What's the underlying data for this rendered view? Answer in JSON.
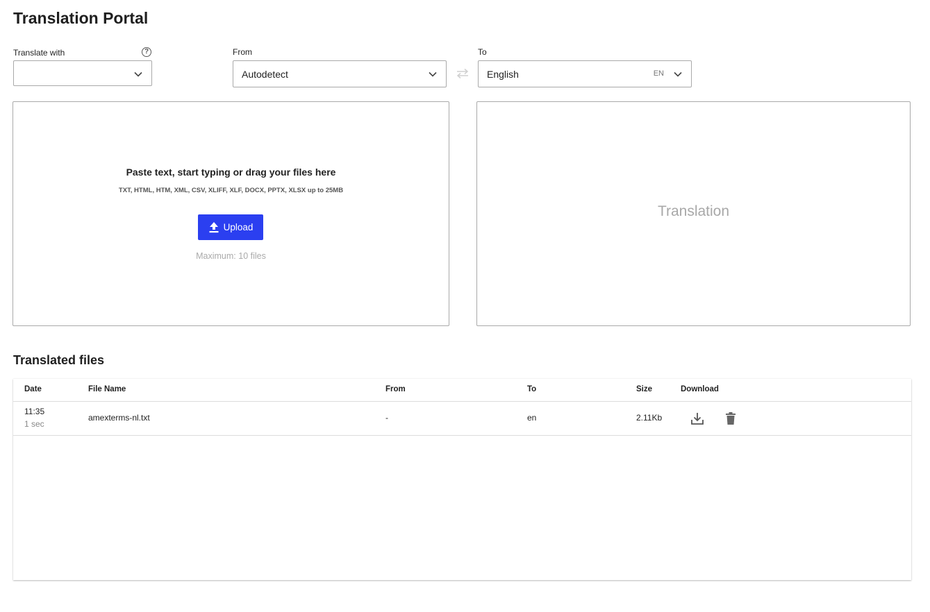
{
  "page_title": "Translation Portal",
  "translate_with": {
    "label": "Translate with",
    "value": "",
    "help_icon": "help-circle-icon"
  },
  "from": {
    "label": "From",
    "value": "Autodetect"
  },
  "to": {
    "label": "To",
    "value": "English",
    "code": "EN"
  },
  "source_panel": {
    "title": "Paste text, start typing or drag your files here",
    "formats": "TXT, HTML, HTM, XML, CSV, XLIFF, XLF, DOCX, PPTX, XLSX up to 25MB",
    "upload_label": "Upload",
    "max_files": "Maximum: 10 files"
  },
  "target_panel": {
    "placeholder": "Translation"
  },
  "translated_files": {
    "title": "Translated files",
    "columns": [
      "Date",
      "File Name",
      "From",
      "To",
      "Size",
      "Download"
    ],
    "rows": [
      {
        "time": "11:35",
        "ago": "1 sec",
        "file_name": "amexterms-nl.txt",
        "from": "-",
        "to": "en",
        "size": "2.11Kb"
      }
    ]
  },
  "colors": {
    "accent": "#2b3ff0",
    "border": "#a9a9a9",
    "placeholder": "#a8a8a8"
  }
}
